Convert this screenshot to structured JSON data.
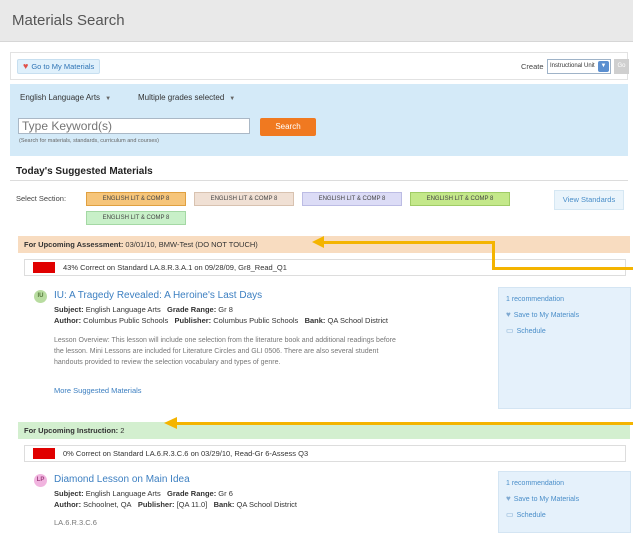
{
  "page": {
    "title": "Materials Search"
  },
  "toolbar": {
    "go_to_my_materials": "Go to My Materials",
    "create_label": "Create",
    "create_selected": "Instructional Unit",
    "go_label": "Go"
  },
  "search": {
    "subject": "English Language Arts",
    "grades": "Multiple grades selected",
    "placeholder": "Type Keyword(s)",
    "button": "Search",
    "hint": "(Search for materials, standards, curriculum and courses)"
  },
  "suggested": {
    "title": "Today's Suggested Materials",
    "select_label": "Select Section:",
    "sections": [
      {
        "label": "ENGLISH LIT & COMP 8",
        "color": "#f6c57a",
        "border": "#e0a040"
      },
      {
        "label": "ENGLISH LIT & COMP 8",
        "color": "#f0e0d4",
        "border": "#d8c2b0"
      },
      {
        "label": "ENGLISH LIT & COMP 8",
        "color": "#dcdcf6",
        "border": "#bcbce4"
      },
      {
        "label": "ENGLISH LIT & COMP 8",
        "color": "#c4e88a",
        "border": "#a0cc66"
      },
      {
        "label": "ENGLISH LIT & COMP 8",
        "color": "#c8f0c8",
        "border": "#a4d8a4"
      }
    ],
    "view_standards": "View Standards"
  },
  "assessment": {
    "heading_bold": "For Upcoming Assessment:",
    "heading_rest": " 03/01/10, BMW-Test (DO NOT TOUCH)",
    "status": "43% Correct on Standard LA.8.R.3.A.1 on 09/28/09, Gr8_Read_Q1",
    "item": {
      "badge": "IU",
      "title": "IU: A Tragedy Revealed: A Heroine's Last Days",
      "subject_label": "Subject:",
      "subject": "English Language Arts",
      "grade_label": "Grade Range:",
      "grade": "Gr 8",
      "author_label": "Author:",
      "author": "Columbus Public Schools",
      "publisher_label": "Publisher:",
      "publisher": "Columbus Public Schools",
      "bank_label": "Bank:",
      "bank": "QA School District",
      "desc_line1": "Lesson Overview: This lesson will include one selection from the literature book and additional readings before",
      "desc_line2": "the lesson. Mini Lessons are included for Literature Circles and GLI 0506. There are also several student",
      "desc_line3": "handouts provided to review the selection vocabulary and types of genre.",
      "more": "More Suggested Materials",
      "recommendation": "1 recommendation",
      "save": "Save to My Materials",
      "schedule": "Schedule"
    }
  },
  "instruction": {
    "heading_bold": "For Upcoming Instruction:",
    "heading_rest": " 2",
    "status": "0% Correct on Standard LA.6.R.3.C.6 on 03/29/10, Read-Gr 6-Assess Q3",
    "item": {
      "badge": "LP",
      "title": "Diamond Lesson on Main Idea",
      "subject_label": "Subject:",
      "subject": "English Language Arts",
      "grade_label": "Grade Range:",
      "grade": "Gr 6",
      "author_label": "Author:",
      "author": "Schoolnet, QA",
      "publisher_label": "Publisher:",
      "publisher": "[QA 11.0]",
      "bank_label": "Bank:",
      "bank": "QA School District",
      "code": "LA.6.R.3.C.6",
      "recommendation": "1 recommendation",
      "save": "Save to My Materials",
      "schedule": "Schedule"
    }
  }
}
